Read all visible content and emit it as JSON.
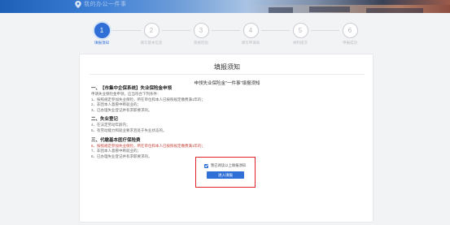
{
  "header": {
    "site_title": "我的办公一件事",
    "icon": "location-pin-icon",
    "brand_color": "#2f6fd6"
  },
  "stepper": {
    "steps": [
      {
        "number": "1",
        "label": "填报须知",
        "active": true
      },
      {
        "number": "2",
        "label": "填写基本信息",
        "active": false
      },
      {
        "number": "3",
        "label": "资格检验",
        "active": false
      },
      {
        "number": "4",
        "label": "填写申请表",
        "active": false
      },
      {
        "number": "5",
        "label": "材料提交",
        "active": false
      },
      {
        "number": "6",
        "label": "申报成功",
        "active": false
      }
    ]
  },
  "card": {
    "title": "填报须知",
    "notice_title": "申领失业保险金\"一件事\"填报须知",
    "sections": [
      {
        "heading": "一、【市集中企保系统】失业保险金申领",
        "lines": [
          {
            "text": "申请失业保险金申领，应当符合下列条件：",
            "red": false
          },
          {
            "text": "1、按照规定参加失业保险，所在单位和本人已按照规定缴费满1年的；",
            "red": false
          },
          {
            "text": "2、非因本人意愿中断就业的；",
            "red": false
          },
          {
            "text": "3、已办理失业登记并有求职要求的。",
            "red": false
          }
        ]
      },
      {
        "heading": "二、失业登记",
        "lines": [
          {
            "text": "4、在法定劳动年龄内；",
            "red": false
          },
          {
            "text": "5、有劳动能力和就业要求且处于失业状态的。",
            "red": false
          }
        ]
      },
      {
        "heading": "三、代缴基本医疗保险费",
        "lines": [
          {
            "text": "6、按照规定参加失业保险，所在单位和本人已按照规定缴费满1年的；",
            "red": true
          },
          {
            "text": "7、非因本人意愿中断就业的；",
            "red": false
          },
          {
            "text": "8、已办理失业登记并有求职要求的。",
            "red": false
          }
        ]
      }
    ],
    "agree_text": "我已阅读以上填报须知",
    "agree_checked": true,
    "enter_button": "进入填报"
  }
}
